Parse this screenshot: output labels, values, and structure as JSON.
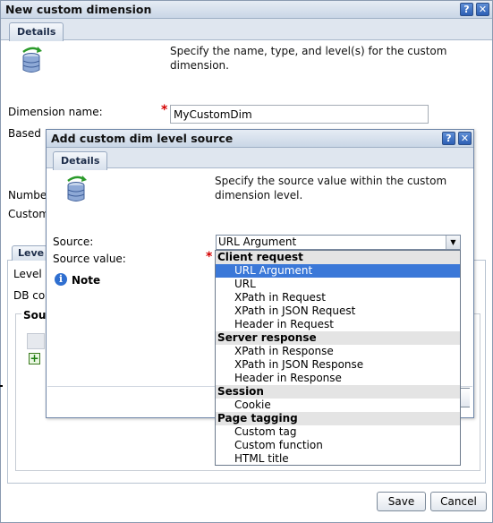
{
  "outer": {
    "title": "New custom dimension",
    "tab_details": "Details",
    "description_line1": "Specify the name, type, and level(s) for the custom",
    "description_line2": "dimension.",
    "dimension_name_label": "Dimension name:",
    "dimension_name_value": "MyCustomDim",
    "based_label_partial": "Based",
    "number_label_partial": "Numbe",
    "custom_label_partial": "Custom",
    "levels_tab_partial": "Leve",
    "level_label_partial": "Level",
    "db_label_partial": "DB co",
    "source_fieldset_partial": "Sou",
    "save_button": "Save",
    "cancel_button": "Cancel"
  },
  "inner": {
    "title": "Add custom dim level source",
    "tab_details": "Details",
    "description_line1": "Specify the source value within the custom",
    "description_line2": "dimension level.",
    "source_label": "Source:",
    "source_selected": "URL Argument",
    "source_value_label": "Source value:",
    "note_label": "Note"
  },
  "dropdown": {
    "groups": [
      {
        "label": "Client request",
        "options": [
          "URL Argument",
          "URL",
          "XPath in Request",
          "XPath in JSON Request",
          "Header in Request"
        ]
      },
      {
        "label": "Server response",
        "options": [
          "XPath in Response",
          "XPath in JSON Response",
          "Header in Response"
        ]
      },
      {
        "label": "Session",
        "options": [
          "Cookie"
        ]
      },
      {
        "label": "Page tagging",
        "options": [
          "Custom tag",
          "Custom function",
          "HTML title"
        ]
      }
    ],
    "selected": "URL Argument"
  },
  "icons": {
    "help": "help-icon",
    "close": "close-icon",
    "database": "database-refresh-icon",
    "info": "info-icon",
    "add": "add-icon",
    "dropdown": "chevron-down-icon"
  },
  "colors": {
    "selection": "#3b78d8",
    "required": "#d40000",
    "group_bg": "#e4e4e4",
    "title_bar": "#c9d6e6"
  }
}
